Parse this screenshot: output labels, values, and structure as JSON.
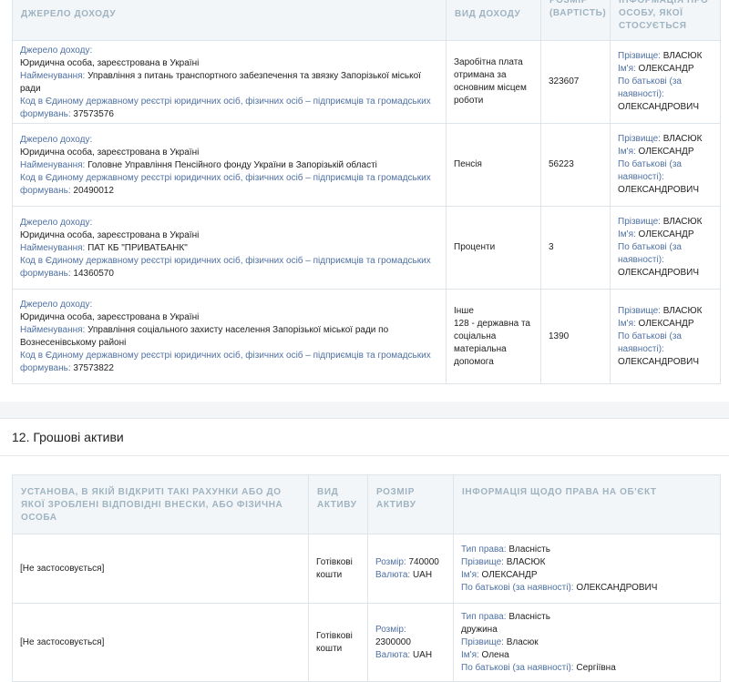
{
  "income_table": {
    "headers": {
      "source": "ДЖЕРЕЛО ДОХОДУ",
      "type": "ВИД ДОХОДУ",
      "amount": "РОЗМІР (ВАРТІСТЬ)",
      "person": "ІНФОРМАЦІЯ ПРО ОСОБУ, ЯКОЇ СТОСУЄТЬСЯ"
    },
    "labels": {
      "source": "Джерело доходу:",
      "name": "Найменування:",
      "code": "Код в Єдиному державному реєстрі юридичних осіб, фізичних осіб – підприємців та громадських формувань:",
      "surname": "Прізвище:",
      "first_name": "Ім'я:",
      "patronymic": "По батькові (за наявності):"
    },
    "rows": [
      {
        "source_type": "Юридична особа, зареєстрована в Україні",
        "name": "Управління з питань транспортного забезпечення та звязку Запорізької міської ради",
        "code": "37573576",
        "type": "Заробітна плата отримана за основним місцем роботи",
        "amount": "323607",
        "surname": "ВЛАСЮК",
        "first_name": "ОЛЕКСАНДР",
        "patronymic": "ОЛЕКСАНДРОВИЧ"
      },
      {
        "source_type": "Юридична особа, зареєстрована в Україні",
        "name": "Головне Управління Пенсійного фонду України в Запорізькій області",
        "code": "20490012",
        "type": "Пенсія",
        "amount": "56223",
        "surname": "ВЛАСЮК",
        "first_name": "ОЛЕКСАНДР",
        "patronymic": "ОЛЕКСАНДРОВИЧ"
      },
      {
        "source_type": "Юридична особа, зареєстрована в Україні",
        "name": "ПАТ КБ \"ПРИВАТБАНК\"",
        "code": "14360570",
        "type": "Проценти",
        "amount": "3",
        "surname": "ВЛАСЮК",
        "first_name": "ОЛЕКСАНДР",
        "patronymic": "ОЛЕКСАНДРОВИЧ"
      },
      {
        "source_type": "Юридична особа, зареєстрована в Україні",
        "name": "Управління соціального захисту населення Запорізької міської ради по Вознесенівському районі",
        "code": "37573822",
        "type": "Інше",
        "type_detail": "128 - державна та соціальна матеріальна допомога",
        "amount": "1390",
        "surname": "ВЛАСЮК",
        "first_name": "ОЛЕКСАНДР",
        "patronymic": "ОЛЕКСАНДРОВИЧ"
      }
    ]
  },
  "section": {
    "title": "12. Грошові активи"
  },
  "assets_table": {
    "headers": {
      "institution": "УСТАНОВА, В ЯКІЙ ВІДКРИТІ ТАКІ РАХУНКИ АБО ДО ЯКОЇ ЗРОБЛЕНІ ВІДПОВІДНІ ВНЕСКИ, АБО ФІЗИЧНА ОСОБА",
      "type": "ВИД АКТИВУ",
      "size": "РОЗМІР АКТИВУ",
      "rights": "ІНФОРМАЦІЯ ЩОДО ПРАВА НА ОБ'ЄКТ"
    },
    "labels": {
      "size": "Розмір:",
      "currency": "Валюта:",
      "right_type": "Тип права:",
      "surname": "Прізвище:",
      "first_name": "Ім'я:",
      "patronymic": "По батькові (за наявності):"
    },
    "rows": [
      {
        "institution": "[Не застосовується]",
        "type": "Готівкові кошти",
        "size": "740000",
        "currency": "UAH",
        "right_type": "Власність",
        "surname": "ВЛАСЮК",
        "first_name": "ОЛЕКСАНДР",
        "patronymic": "ОЛЕКСАНДРОВИЧ"
      },
      {
        "institution": "[Не застосовується]",
        "type": "Готівкові кошти",
        "size": "2300000",
        "currency": "UAH",
        "right_type": "Власність",
        "right_holder": "дружина",
        "surname": "Власюк",
        "first_name": "Олена",
        "patronymic": "Сергіївна"
      }
    ]
  }
}
